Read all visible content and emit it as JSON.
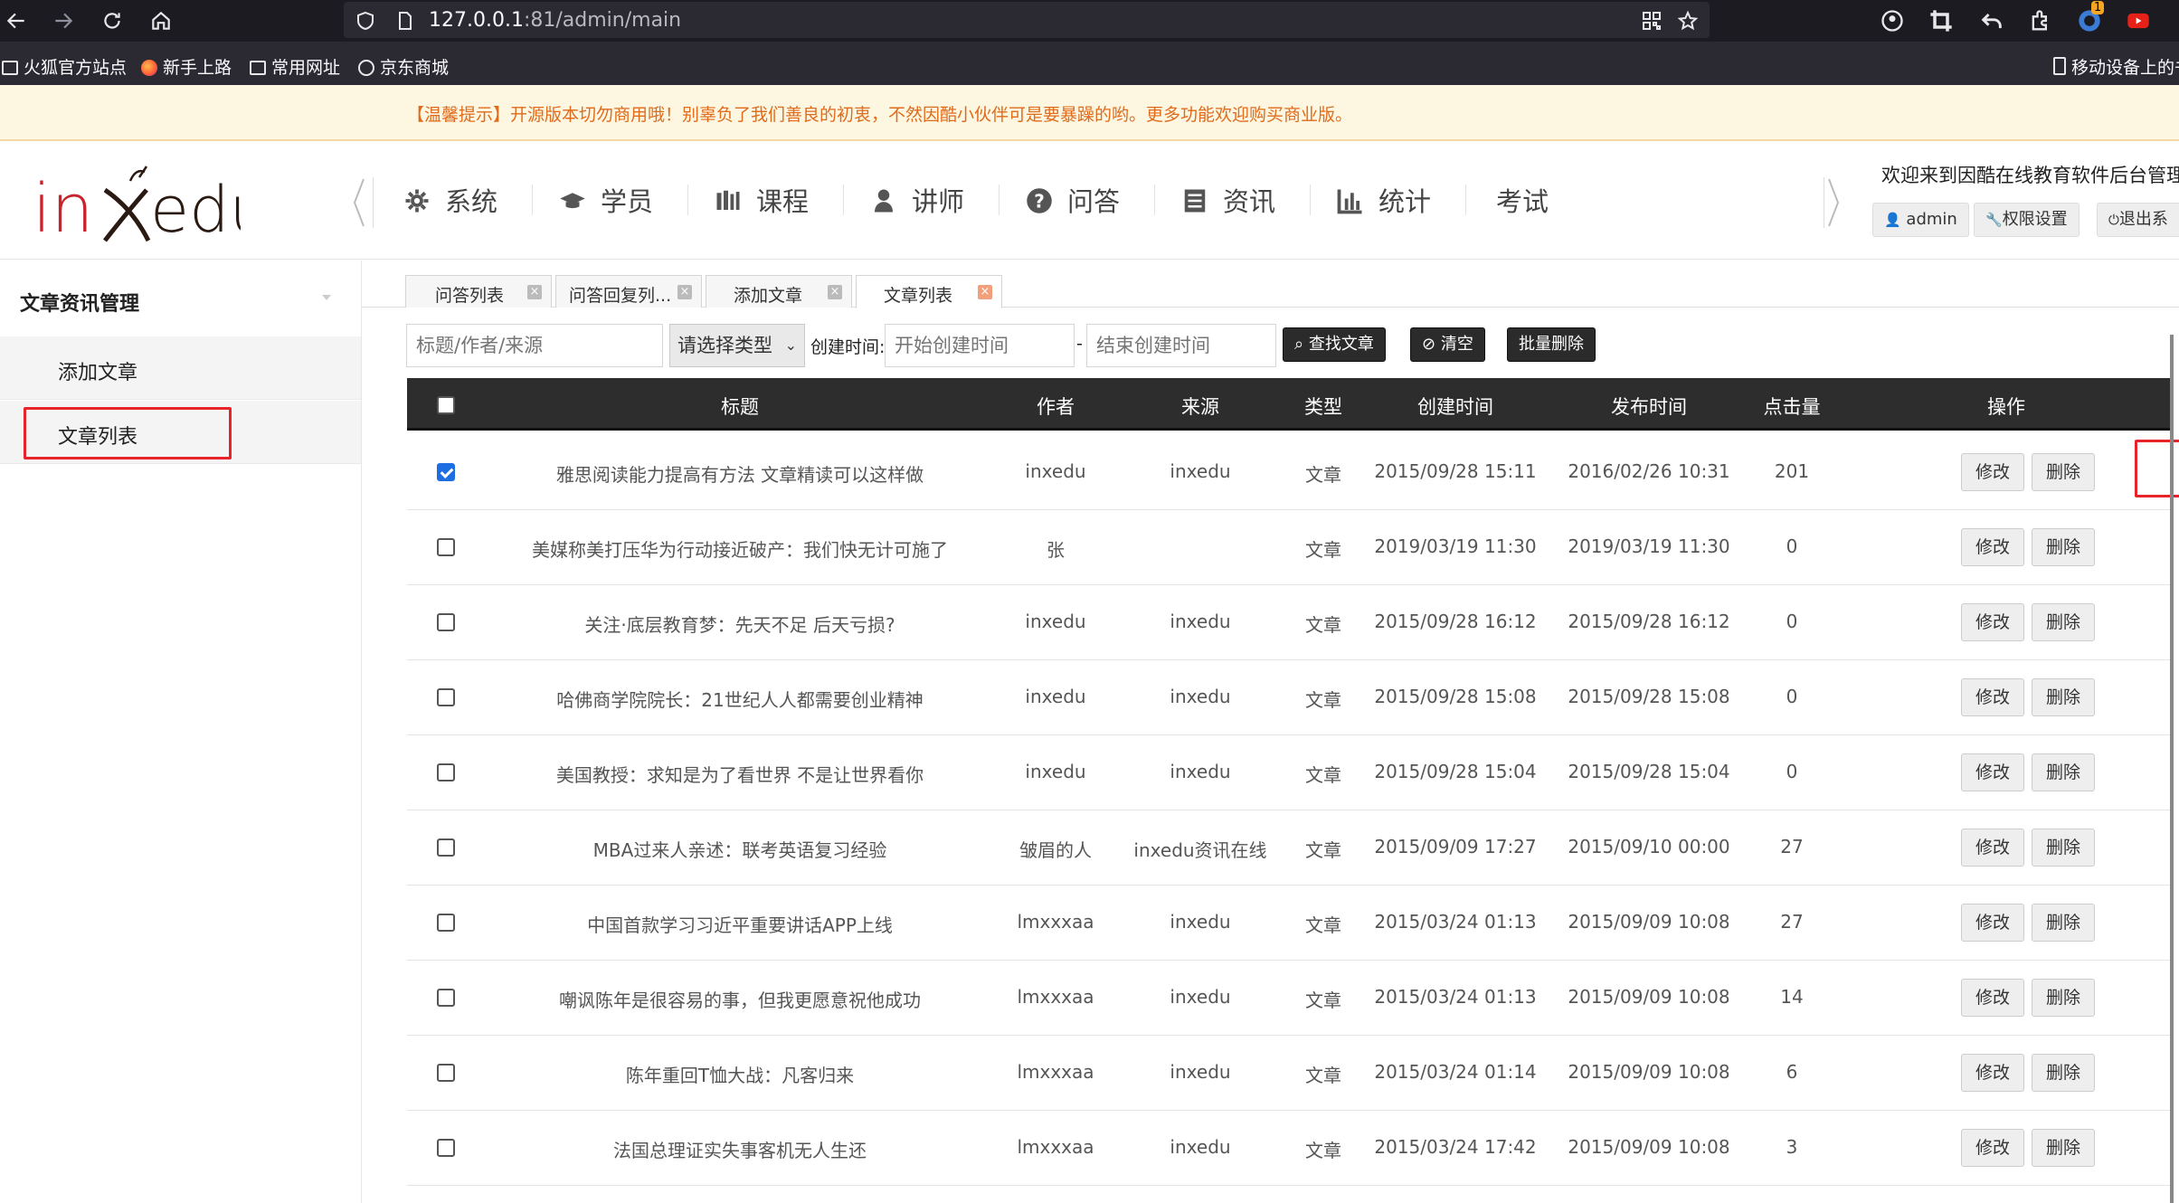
{
  "browser": {
    "url_prefix": "127.0.0.1",
    "url_suffix": ":81/admin/main",
    "bookmarks": [
      "火狐官方站点",
      "新手上路",
      "常用网址",
      "京东商城"
    ],
    "mobile_bookmarks": "移动设备上的书",
    "notification_badge": "1"
  },
  "notice": "【温馨提示】开源版本切勿商用哦！别辜负了我们善良的初衷，不然因酷小伙伴可是要暴躁的哟。更多功能欢迎购买商业版。",
  "header": {
    "menu": [
      {
        "label": "系统",
        "icon": "gear-icon"
      },
      {
        "label": "学员",
        "icon": "graduation-cap-icon"
      },
      {
        "label": "课程",
        "icon": "books-icon"
      },
      {
        "label": "讲师",
        "icon": "user-icon"
      },
      {
        "label": "问答",
        "icon": "question-circle-icon"
      },
      {
        "label": "资讯",
        "icon": "newspaper-icon"
      },
      {
        "label": "统计",
        "icon": "bar-chart-icon"
      },
      {
        "label": "考试",
        "icon": ""
      }
    ],
    "welcome": "欢迎来到因酷在线教育软件后台管理系",
    "admin_label": "admin",
    "permission_label": "权限设置",
    "logout_label": "退出系"
  },
  "sidebar": {
    "title": "文章资讯管理",
    "items": [
      "添加文章",
      "文章列表"
    ],
    "active": "文章列表"
  },
  "tabs": [
    {
      "label": "问答列表",
      "active": false
    },
    {
      "label": "问答回复列...",
      "active": false
    },
    {
      "label": "添加文章",
      "active": false
    },
    {
      "label": "文章列表",
      "active": true
    }
  ],
  "search": {
    "keyword_placeholder": "标题/作者/来源",
    "type_selected": "请选择类型",
    "created_label": "创建时间:",
    "start_placeholder": "开始创建时间",
    "dash": "-",
    "end_placeholder": "结束创建时间",
    "search_button": "查找文章",
    "clear_button": "清空",
    "batch_delete_button": "批量删除"
  },
  "table": {
    "columns": [
      "标题",
      "作者",
      "来源",
      "类型",
      "创建时间",
      "发布时间",
      "点击量",
      "操作"
    ],
    "edit_label": "修改",
    "delete_label": "删除",
    "rows": [
      {
        "title": "雅思阅读能力提高有方法 文章精读可以这样做",
        "author": "inxedu",
        "source": "inxedu",
        "type": "文章",
        "created": "2015/09/28 15:11",
        "published": "2016/02/26 10:31",
        "clicks": "201",
        "checked": true
      },
      {
        "title": "美媒称美打压华为行动接近破产：我们快无计可施了",
        "author": "张",
        "source": "",
        "type": "文章",
        "created": "2019/03/19 11:30",
        "published": "2019/03/19 11:30",
        "clicks": "0",
        "checked": false
      },
      {
        "title": "关注·底层教育梦：先天不足 后天亏损?",
        "author": "inxedu",
        "source": "inxedu",
        "type": "文章",
        "created": "2015/09/28 16:12",
        "published": "2015/09/28 16:12",
        "clicks": "0",
        "checked": false
      },
      {
        "title": "哈佛商学院院长：21世纪人人都需要创业精神",
        "author": "inxedu",
        "source": "inxedu",
        "type": "文章",
        "created": "2015/09/28 15:08",
        "published": "2015/09/28 15:08",
        "clicks": "0",
        "checked": false
      },
      {
        "title": "美国教授：求知是为了看世界 不是让世界看你",
        "author": "inxedu",
        "source": "inxedu",
        "type": "文章",
        "created": "2015/09/28 15:04",
        "published": "2015/09/28 15:04",
        "clicks": "0",
        "checked": false
      },
      {
        "title": "MBA过来人亲述：联考英语复习经验",
        "author": "皱眉的人",
        "source": "inxedu资讯在线",
        "type": "文章",
        "created": "2015/09/09 17:27",
        "published": "2015/09/10 00:00",
        "clicks": "27",
        "checked": false
      },
      {
        "title": "中国首款学习习近平重要讲话APP上线",
        "author": "lmxxxaa",
        "source": "inxedu",
        "type": "文章",
        "created": "2015/03/24 01:13",
        "published": "2015/09/09 10:08",
        "clicks": "27",
        "checked": false
      },
      {
        "title": "嘲讽陈年是很容易的事，但我更愿意祝他成功",
        "author": "lmxxxaa",
        "source": "inxedu",
        "type": "文章",
        "created": "2015/03/24 01:13",
        "published": "2015/09/09 10:08",
        "clicks": "14",
        "checked": false
      },
      {
        "title": "陈年重回T恤大战：凡客归来",
        "author": "lmxxxaa",
        "source": "inxedu",
        "type": "文章",
        "created": "2015/03/24 01:14",
        "published": "2015/09/09 10:08",
        "clicks": "6",
        "checked": false
      },
      {
        "title": "法国总理证实失事客机无人生还",
        "author": "lmxxxaa",
        "source": "inxedu",
        "type": "文章",
        "created": "2015/03/24 17:42",
        "published": "2015/09/09 10:08",
        "clicks": "3",
        "checked": false
      }
    ]
  }
}
